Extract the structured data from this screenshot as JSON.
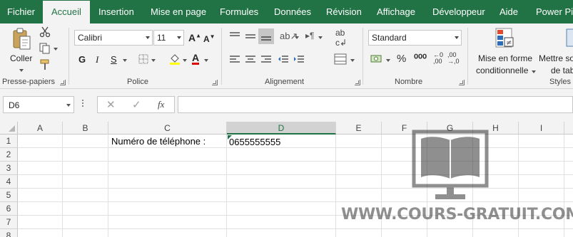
{
  "tabs": [
    "Fichier",
    "Accueil",
    "Insertion",
    "Mise en page",
    "Formules",
    "Données",
    "Révision",
    "Affichage",
    "Développeur",
    "Aide",
    "Power Piv"
  ],
  "active_tab": "Accueil",
  "ribbon": {
    "clipboard": {
      "paste_label": "Coller",
      "group_label": "Presse-papiers"
    },
    "font": {
      "font_name": "Calibri",
      "font_size": "11",
      "bold": "G",
      "italic": "I",
      "underline": "S",
      "group_label": "Police"
    },
    "alignment": {
      "group_label": "Alignement"
    },
    "number": {
      "format": "Standard",
      "group_label": "Nombre"
    },
    "styles": {
      "conditional_format_line1": "Mise en forme",
      "conditional_format_line2": "conditionnelle",
      "table_format_line1": "Mettre so",
      "table_format_line2": "de tab",
      "group_label": "Styles"
    }
  },
  "formula_bar": {
    "name_box": "D6",
    "fx": "fx",
    "formula": ""
  },
  "sheet": {
    "columns": [
      "A",
      "B",
      "C",
      "D",
      "E",
      "F",
      "G",
      "H",
      "I"
    ],
    "selected_column": "D",
    "rows": [
      "1",
      "2",
      "3",
      "4",
      "5",
      "6",
      "7",
      "8"
    ],
    "cells": {
      "C1": "Numéro de téléphone :",
      "D1": "0655555555"
    }
  },
  "watermark": {
    "text": "WWW.COURS-GRATUIT.COM"
  },
  "colors": {
    "excel_green": "#217346",
    "ribbon_bg": "#f3f3f3",
    "grid_line": "#e1e1e1"
  }
}
